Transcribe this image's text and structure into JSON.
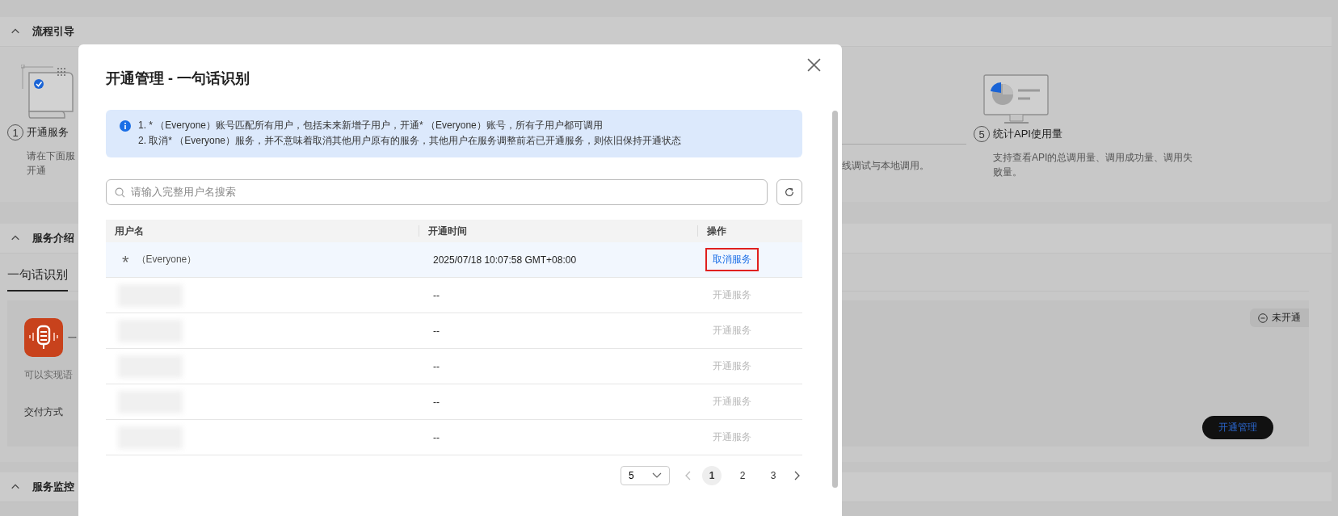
{
  "flow_guide": {
    "title": "流程引导",
    "expanded": true,
    "steps": [
      {
        "number": "1",
        "label": "开通服务",
        "kind": "open",
        "description": [
          "请在下面服",
          "开通"
        ]
      },
      {
        "number": "5",
        "label": "统计API使用量",
        "kind": "stats",
        "description": [
          "支持查看API的总调用量、调用成功量、调用失",
          "败量。"
        ]
      }
    ],
    "partial_description": "线调试与本地调用。"
  },
  "service_intro": {
    "title": "服务介绍",
    "expanded": true,
    "tabs": [
      {
        "label": "一句话识别",
        "selected": true
      }
    ],
    "card": {
      "title": "一",
      "description": "可以实现语",
      "delivery_label": "交付方式",
      "status": {
        "label": "未开通",
        "kind": "inactive"
      },
      "button": "开通管理"
    }
  },
  "service_monitor": {
    "title": "服务监控",
    "expanded": true
  },
  "modal": {
    "title": "开通管理 - 一句话识别",
    "notice": [
      "1. * （Everyone）账号匹配所有用户，包括未来新增子用户，开通* （Everyone）账号，所有子用户都可调用",
      "2. 取消* （Everyone）服务，并不意味着取消其他用户原有的服务，其他用户在服务调整前若已开通服务，则依旧保持开通状态"
    ],
    "search": {
      "placeholder": "请输入完整用户名搜索"
    },
    "table": {
      "columns": [
        "用户名",
        "开通时间",
        "操作"
      ],
      "rows": [
        {
          "kind": "everyone",
          "user_mark": "*",
          "user": "（Everyone）",
          "time": "2025/07/18 10:07:58 GMT+08:00",
          "action": "取消服务",
          "disabled": false,
          "selected": true,
          "annotated": true
        },
        {
          "kind": "redacted",
          "time": "--",
          "action": "开通服务",
          "disabled": true,
          "selected": false,
          "annotated": false
        },
        {
          "kind": "redacted",
          "time": "--",
          "action": "开通服务",
          "disabled": true,
          "selected": false,
          "annotated": false
        },
        {
          "kind": "redacted",
          "time": "--",
          "action": "开通服务",
          "disabled": true,
          "selected": false,
          "annotated": false
        },
        {
          "kind": "redacted",
          "time": "--",
          "action": "开通服务",
          "disabled": true,
          "selected": false,
          "annotated": false
        },
        {
          "kind": "redacted",
          "time": "--",
          "action": "开通服务",
          "disabled": true,
          "selected": false,
          "annotated": false
        }
      ]
    },
    "pagination": {
      "page_size": "5",
      "pages": [
        {
          "label": "1",
          "selected": true
        },
        {
          "label": "2",
          "selected": false
        },
        {
          "label": "3",
          "selected": false
        }
      ]
    }
  }
}
